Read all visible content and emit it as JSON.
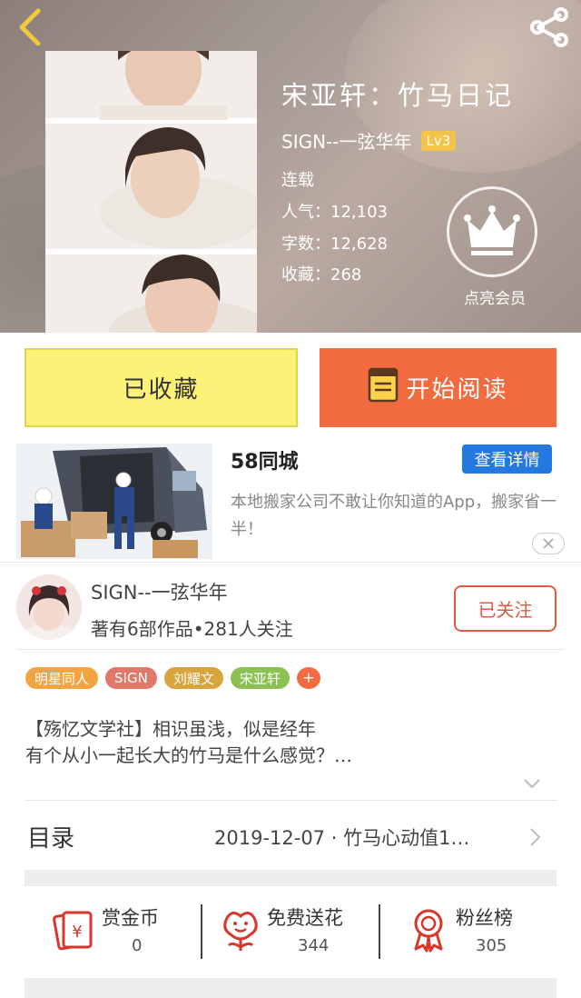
{
  "header": {
    "book_title": "宋亚轩：竹马日记",
    "author": "SIGN--一弦华年",
    "level": "Lv3",
    "status": "连载",
    "popularity": "人气：12,103",
    "word_count": "字数：12,628",
    "favorites": "收藏：268",
    "vip_label": "点亮会员"
  },
  "actions": {
    "collect_label": "已收藏",
    "read_label": "开始阅读"
  },
  "ad": {
    "title": "58同城",
    "detail_button": "查看详情",
    "description": "本地搬家公司不敢让你知道的App，搬家省一半！"
  },
  "author_card": {
    "name": "SIGN--一弦华年",
    "stats": "著有6部作品•281人关注",
    "follow_label": "已关注"
  },
  "tags": [
    {
      "label": "明星同人",
      "color": "#f0a542"
    },
    {
      "label": "SIGN",
      "color": "#e0796a"
    },
    {
      "label": "刘耀文",
      "color": "#d9a33d"
    },
    {
      "label": "宋亚轩",
      "color": "#8cc152"
    }
  ],
  "tag_plus": "+",
  "intro": {
    "line1": "【殇忆文学社】相识虽浅，似是经年",
    "line2": "有个从小一起长大的竹马是什么感觉？…"
  },
  "toc": {
    "label": "目录",
    "latest": "2019-12-07 · 竹马心动值1…"
  },
  "bottom": [
    {
      "label": "赏金币",
      "count": "0"
    },
    {
      "label": "免费送花",
      "count": "344"
    },
    {
      "label": "粉丝榜",
      "count": "305"
    }
  ],
  "colors": {
    "accent_orange": "#f26a3f",
    "collect_yellow": "#fdf278",
    "follow_red": "#e05a43",
    "ad_blue": "#2479df"
  }
}
